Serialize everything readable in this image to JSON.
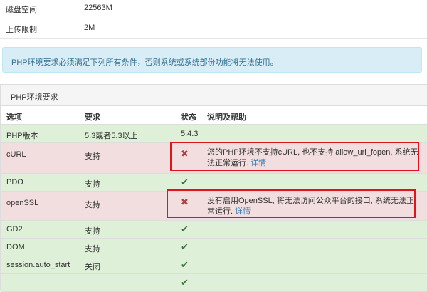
{
  "info": [
    {
      "key": "磁盘空间",
      "value": "22563M"
    },
    {
      "key": "上传限制",
      "value": "2M"
    }
  ],
  "alert_text": "PHP环境要求必须满足下列所有条件，否则系统或系统部份功能将无法使用。",
  "panel_title": "PHP环境要求",
  "table_headers": {
    "option": "选项",
    "requirement": "要求",
    "status": "状态",
    "help": "说明及帮助"
  },
  "rows": [
    {
      "option": "PHP版本",
      "requirement": "5.3或者5.3以上",
      "status": "5.4.3",
      "help": "",
      "help_link": ""
    },
    {
      "option": "cURL",
      "requirement": "支持",
      "status_icon": "cross-icon",
      "help": "您的PHP环境不支持cURL, 也不支持 allow_url_fopen, 系统无法正常运行.",
      "help_link": "详情"
    },
    {
      "option": "PDO",
      "requirement": "支持",
      "status_icon": "check-icon"
    },
    {
      "option": "openSSL",
      "requirement": "支持",
      "status_icon": "cross-icon",
      "help": "没有启用OpenSSL, 将无法访问公众平台的接口, 系统无法正常运行.",
      "help_link": "详情"
    },
    {
      "option": "GD2",
      "requirement": "支持",
      "status_icon": "check-icon"
    },
    {
      "option": "DOM",
      "requirement": "支持",
      "status_icon": "check-icon"
    },
    {
      "option": "session.auto_start",
      "requirement": "关闭",
      "status_icon": "check-icon"
    }
  ],
  "colors": {
    "ok_row": "#dff0d8",
    "error_row": "#f2dede",
    "highlight": "#e0141e",
    "link": "#337ab7"
  }
}
